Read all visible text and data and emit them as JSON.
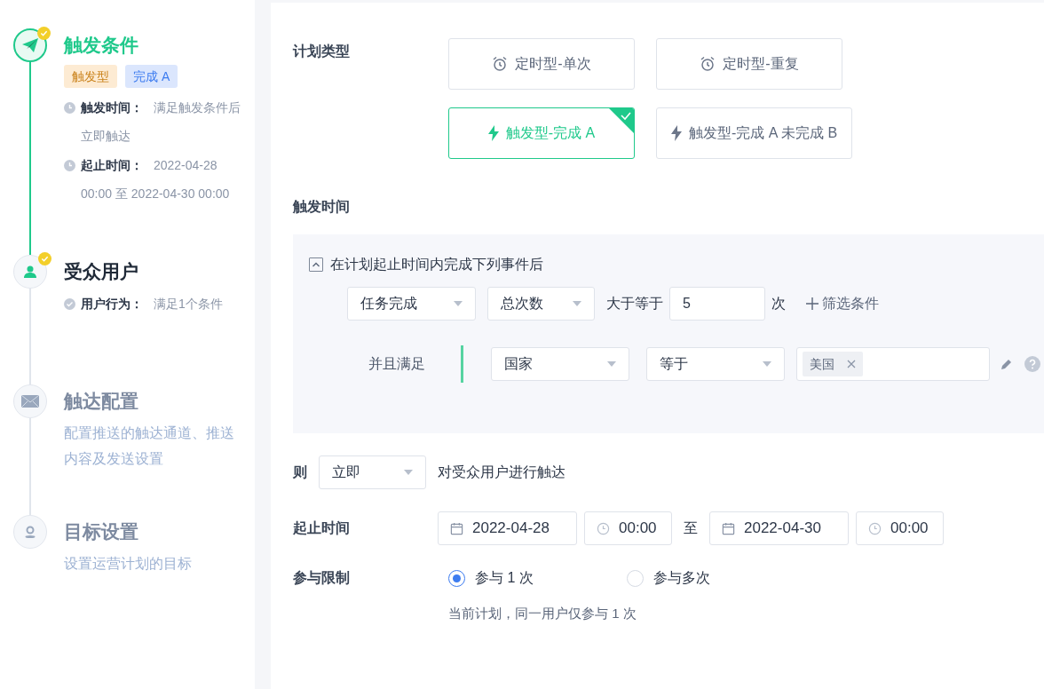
{
  "steps": [
    {
      "kind": "send",
      "title": "触发条件",
      "selected": true,
      "disabled": false,
      "done": true,
      "tags": [
        {
          "text": "触发型",
          "kind": "type"
        },
        {
          "text": "完成 A",
          "kind": "event"
        }
      ],
      "details": [
        {
          "kind": "clock",
          "text": "**触发时间：** 满足触发条件后立即触达"
        },
        {
          "kind": "clock",
          "text": "**起止时间：** 2022-04-28 00:00 至 2022-04-30 00:00"
        }
      ]
    },
    {
      "kind": "audience",
      "title": "受众用户",
      "selected": false,
      "disabled": false,
      "done": true,
      "details": [
        {
          "kind": "check",
          "text": "**用户行为：** 满足1个条件"
        }
      ]
    },
    {
      "kind": "mail",
      "title": "触达配置",
      "selected": false,
      "disabled": true,
      "done": false,
      "description": "配置推送的触达通道、推送内容及发送设置"
    },
    {
      "kind": "goal",
      "title": "目标设置",
      "selected": false,
      "disabled": true,
      "done": false,
      "description": "设置运营计划的目标"
    }
  ],
  "plan_type": {
    "label": "计划类型",
    "options": [
      {
        "label": "定时型-单次",
        "kind": "timer",
        "selected": false
      },
      {
        "label": "定时型-重复",
        "kind": "timer",
        "selected": false
      },
      {
        "label": "触发型-完成 A",
        "kind": "trigger",
        "selected": true
      },
      {
        "label": "触发型-完成 A 未完成 B",
        "kind": "trigger",
        "selected": false
      }
    ]
  },
  "trigger_time": {
    "label": "触发时间"
  },
  "trigger_panel": {
    "expanded": true,
    "title": "在计划起止时间内完成下列事件后",
    "event": "任务完成",
    "metric": "总次数",
    "operator": "大于等于",
    "value": "5",
    "unit": "次",
    "add_filter": "筛选条件",
    "filter": {
      "conjunction": "并且满足",
      "field": "国家",
      "operator": "等于",
      "tags": [
        "美国"
      ]
    }
  },
  "then": {
    "label": "则",
    "timing": "立即",
    "text": "对受众用户进行触达"
  },
  "period": {
    "label": "起止时间",
    "start_date": "2022-04-28",
    "start_time": "00:00",
    "separator": "至",
    "end_date": "2022-04-30",
    "end_time": "00:00"
  },
  "limit": {
    "label": "参与限制",
    "options": [
      {
        "label": "参与 1 次",
        "selected": true
      },
      {
        "label": "参与多次",
        "selected": false
      }
    ],
    "hint": "当前计划，同一用户仅参与 1 次"
  }
}
